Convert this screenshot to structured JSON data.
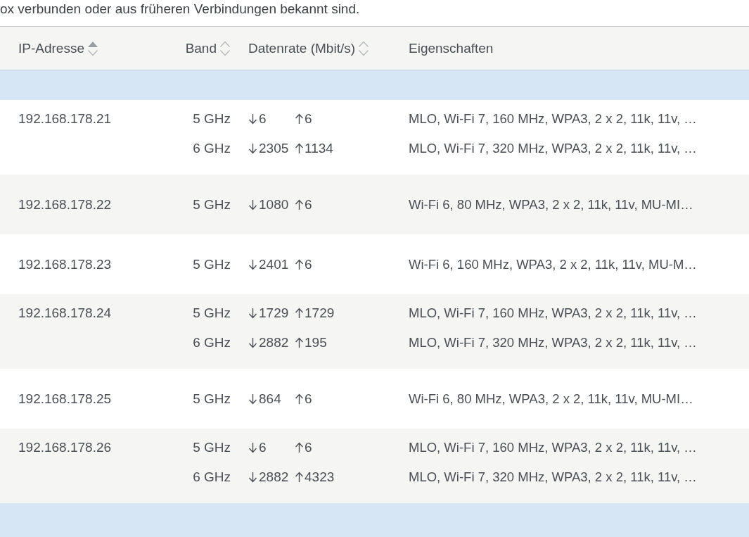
{
  "intro": "ox verbunden oder aus früheren Verbindungen bekannt sind.",
  "table": {
    "columns": [
      {
        "label": "IP-Adresse",
        "sorted": true
      },
      {
        "label": "Band",
        "sorted": false
      },
      {
        "label": "Datenrate (Mbit/s)",
        "sorted": false
      },
      {
        "label": "Eigenschaften"
      }
    ],
    "rows": [
      {
        "ip": "192.168.178.21",
        "links": [
          {
            "band": "5 GHz",
            "down": "6",
            "up": "6",
            "properties": "MLO, Wi-Fi 7, 160 MHz, WPA3, 2 x 2, 11k, 11v, …"
          },
          {
            "band": "6 GHz",
            "down": "2305",
            "up": "1134",
            "properties": "MLO, Wi-Fi 7, 320 MHz, WPA3, 2 x 2, 11k, 11v, …"
          }
        ]
      },
      {
        "ip": "192.168.178.22",
        "links": [
          {
            "band": "5 GHz",
            "down": "1080",
            "up": "6",
            "properties": "Wi-Fi 6, 80 MHz, WPA3, 2 x 2, 11k, 11v, MU-MI…"
          }
        ]
      },
      {
        "ip": "192.168.178.23",
        "links": [
          {
            "band": "5 GHz",
            "down": "2401",
            "up": "6",
            "properties": "Wi-Fi 6, 160 MHz, WPA3, 2 x 2, 11k, 11v, MU-M…"
          }
        ]
      },
      {
        "ip": "192.168.178.24",
        "links": [
          {
            "band": "5 GHz",
            "down": "1729",
            "up": "1729",
            "properties": "MLO, Wi-Fi 7, 160 MHz, WPA3, 2 x 2, 11k, 11v, …"
          },
          {
            "band": "6 GHz",
            "down": "2882",
            "up": "195",
            "properties": "MLO, Wi-Fi 7, 320 MHz, WPA3, 2 x 2, 11k, 11v, …"
          }
        ]
      },
      {
        "ip": "192.168.178.25",
        "links": [
          {
            "band": "5 GHz",
            "down": "864",
            "up": "6",
            "properties": "Wi-Fi 6, 80 MHz, WPA3, 2 x 2, 11k, 11v, MU-MI…"
          }
        ]
      },
      {
        "ip": "192.168.178.26",
        "links": [
          {
            "band": "5 GHz",
            "down": "6",
            "up": "6",
            "properties": "MLO, Wi-Fi 7, 160 MHz, WPA3, 2 x 2, 11k, 11v, …"
          },
          {
            "band": "6 GHz",
            "down": "2882",
            "up": "4323",
            "properties": "MLO, Wi-Fi 7, 320 MHz, WPA3, 2 x 2, 11k, 11v, …"
          }
        ]
      }
    ]
  }
}
